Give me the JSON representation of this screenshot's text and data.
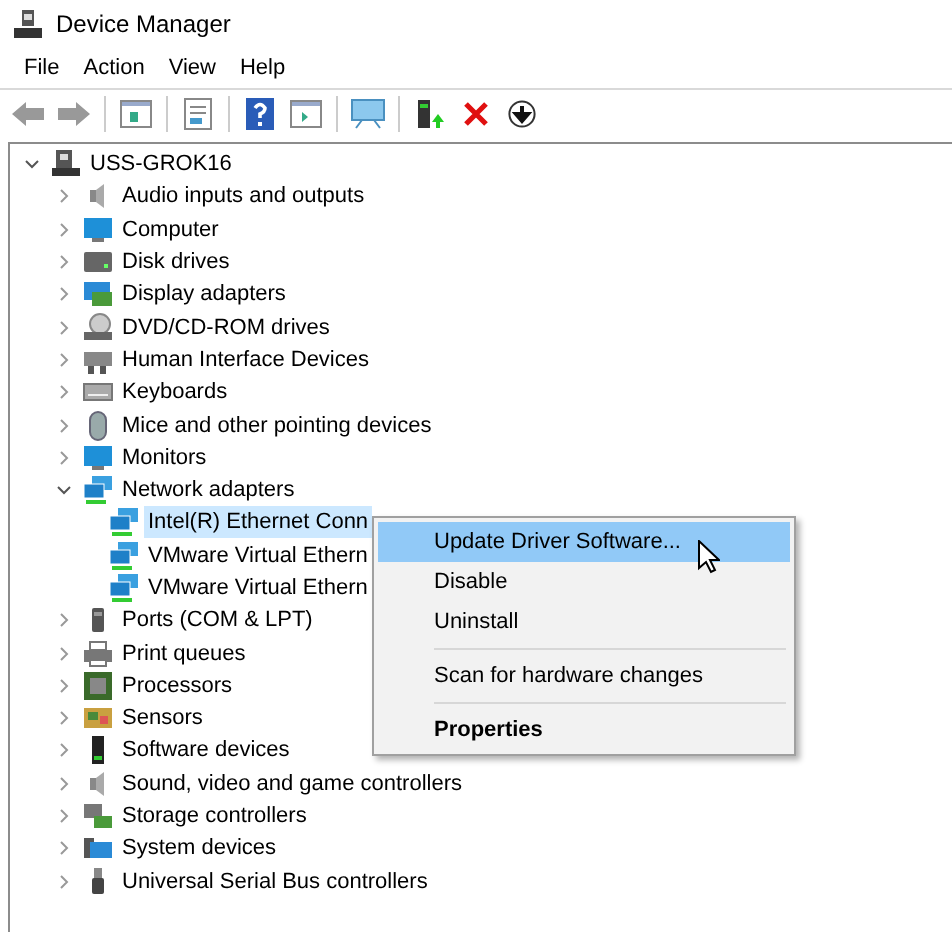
{
  "window": {
    "title": "Device Manager"
  },
  "menu_bar": [
    "File",
    "Action",
    "View",
    "Help"
  ],
  "tree": {
    "label": "USS-GROK16",
    "expanded": true,
    "children": [
      {
        "label": "Audio inputs and outputs",
        "expanded": false
      },
      {
        "label": "Computer",
        "expanded": false
      },
      {
        "label": "Disk drives",
        "expanded": false
      },
      {
        "label": "Display adapters",
        "expanded": false
      },
      {
        "label": "DVD/CD-ROM drives",
        "expanded": false
      },
      {
        "label": "Human Interface Devices",
        "expanded": false
      },
      {
        "label": "Keyboards",
        "expanded": false
      },
      {
        "label": "Mice and other pointing devices",
        "expanded": false
      },
      {
        "label": "Monitors",
        "expanded": false
      },
      {
        "label": "Network adapters",
        "expanded": true,
        "children": [
          {
            "label": "Intel(R) Ethernet Conn",
            "selected": true
          },
          {
            "label": "VMware Virtual Ethern",
            "selected": false
          },
          {
            "label": "VMware Virtual Ethern",
            "selected": false
          }
        ]
      },
      {
        "label": "Ports (COM & LPT)",
        "expanded": false
      },
      {
        "label": "Print queues",
        "expanded": false
      },
      {
        "label": "Processors",
        "expanded": false
      },
      {
        "label": "Sensors",
        "expanded": false
      },
      {
        "label": "Software devices",
        "expanded": false
      },
      {
        "label": "Sound, video and game controllers",
        "expanded": false
      },
      {
        "label": "Storage controllers",
        "expanded": false
      },
      {
        "label": "System devices",
        "expanded": false
      },
      {
        "label": "Universal Serial Bus controllers",
        "expanded": false
      }
    ]
  },
  "context_menu": [
    {
      "label": "Update Driver Software...",
      "selected": true,
      "separator_before": false,
      "default": false
    },
    {
      "label": "Disable",
      "selected": false,
      "separator_before": false,
      "default": false
    },
    {
      "label": "Uninstall",
      "selected": false,
      "separator_before": false,
      "default": false
    },
    {
      "label": "Scan for hardware changes",
      "selected": false,
      "separator_before": true,
      "default": false
    },
    {
      "label": "Properties",
      "selected": false,
      "separator_before": true,
      "default": true
    }
  ]
}
